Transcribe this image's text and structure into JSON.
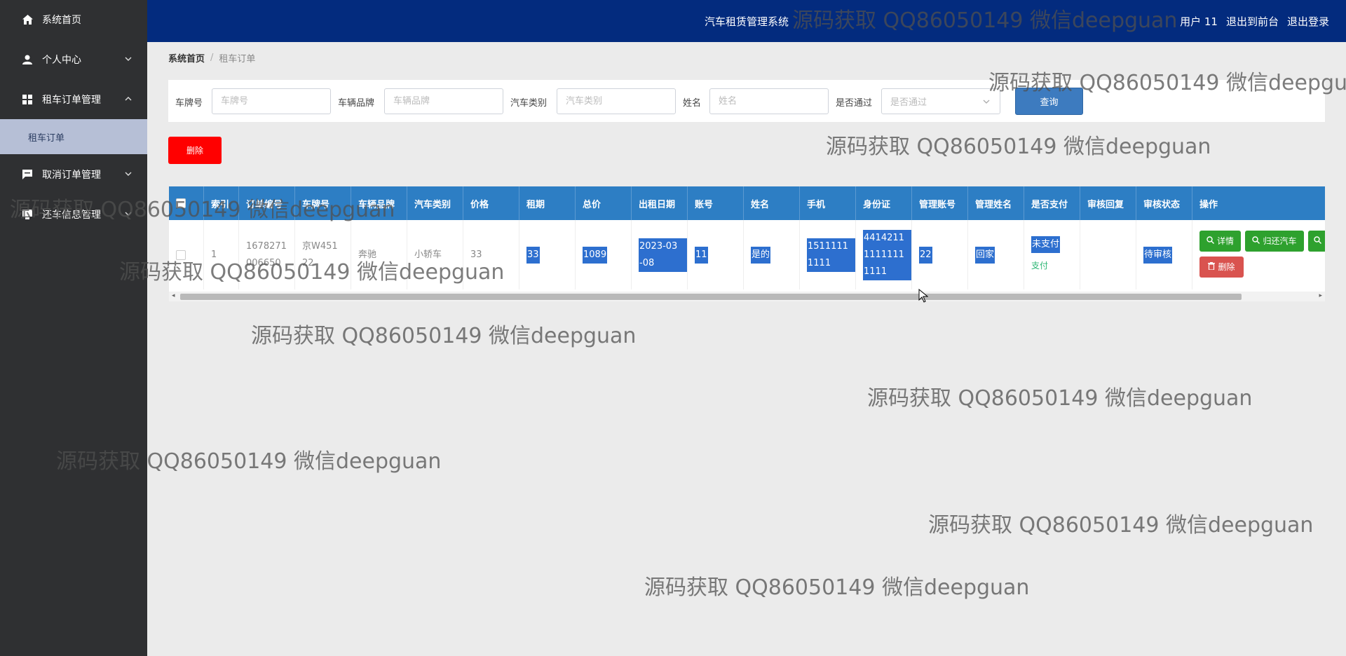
{
  "sidebar": {
    "items": [
      {
        "label": "系统首页",
        "icon": "home-icon",
        "expanded": null
      },
      {
        "label": "个人中心",
        "icon": "user-icon",
        "expanded": false
      },
      {
        "label": "租车订单管理",
        "icon": "grid-icon",
        "expanded": true
      },
      {
        "label": "取消订单管理",
        "icon": "chat-icon",
        "expanded": false
      },
      {
        "label": "还车信息管理",
        "icon": "monitor-icon",
        "expanded": false
      }
    ],
    "active_sub": "租车订单"
  },
  "header": {
    "title": "汽车租赁管理系统",
    "user": "用户 11",
    "to_front": "退出到前台",
    "logout": "退出登录"
  },
  "breadcrumb": {
    "home": "系统首页",
    "current": "租车订单"
  },
  "search": {
    "plate_label": "车牌号",
    "plate_placeholder": "车牌号",
    "brand_label": "车辆品牌",
    "brand_placeholder": "车辆品牌",
    "type_label": "汽车类别",
    "type_placeholder": "汽车类别",
    "name_label": "姓名",
    "name_placeholder": "姓名",
    "pass_label": "是否通过",
    "pass_placeholder": "是否通过",
    "query_label": "查询"
  },
  "actions": {
    "delete_label": "删除"
  },
  "table": {
    "headers": [
      "",
      "索引",
      "订单编号",
      "车牌号",
      "车辆品牌",
      "汽车类别",
      "价格",
      "租期",
      "总价",
      "出租日期",
      "账号",
      "姓名",
      "手机",
      "身份证",
      "管理账号",
      "管理姓名",
      "是否支付",
      "审核回复",
      "审核状态",
      "操作"
    ],
    "row": {
      "index": "1",
      "order_no": "1678271 006650",
      "plate": "京W451 22",
      "brand": "奔驰",
      "type": "小轿车",
      "price": "33",
      "term": "33",
      "total": "1089",
      "date": "2023-03 -08",
      "account": "11",
      "name": "是的",
      "phone": "1511111 1111",
      "id_card": "4414211 1111111 1111",
      "admin_account": "22",
      "admin_name": "回家",
      "paid": "未支付",
      "pay_link": "支付",
      "reply": "",
      "status": "待审核",
      "btn_detail": "详情",
      "btn_return": "归还汽车",
      "btn_delete": "删除"
    }
  },
  "watermark": "源码获取 QQ86050149 微信deepguan"
}
